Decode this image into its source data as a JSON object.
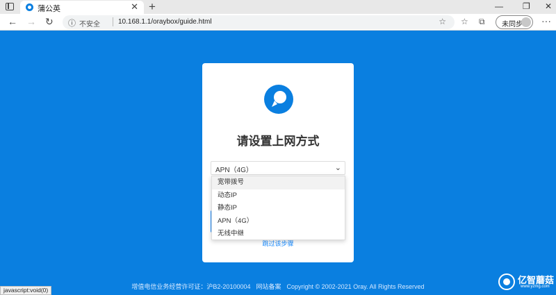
{
  "browser": {
    "tab_title": "蒲公英",
    "tab_close": "✕",
    "new_tab": "+",
    "minimize": "—",
    "maximize": "❐",
    "close": "✕",
    "back": "←",
    "forward": "→",
    "reload": "↻",
    "info_icon": "ⓘ",
    "security_label": "不安全",
    "url": "10.168.1.1/oraybox/guide.html",
    "star": "☆",
    "favorites": "☆",
    "collections": "⧉",
    "sync_label": "未同步",
    "more": "···"
  },
  "card": {
    "title": "请设置上网方式",
    "select_value": "APN（4G）",
    "select_arrow": "⌄",
    "options": [
      "宽带拨号",
      "动态IP",
      "静态IP",
      "APN（4G）",
      "无线中继"
    ],
    "skip_link": "跳过该步骤"
  },
  "footer": {
    "license": "增值电信业务经营许可证：沪B2-20100004",
    "icp": "网站备案",
    "copyright": "Copyright © 2002-2021 Oray. All Rights Reserved"
  },
  "status_bar": "javascript:void(0)",
  "watermark": {
    "text": "亿智蘑菇",
    "sub": "www.yzmg.com"
  },
  "colors": {
    "background": "#0a7fe0",
    "accent": "#1a8cff"
  }
}
